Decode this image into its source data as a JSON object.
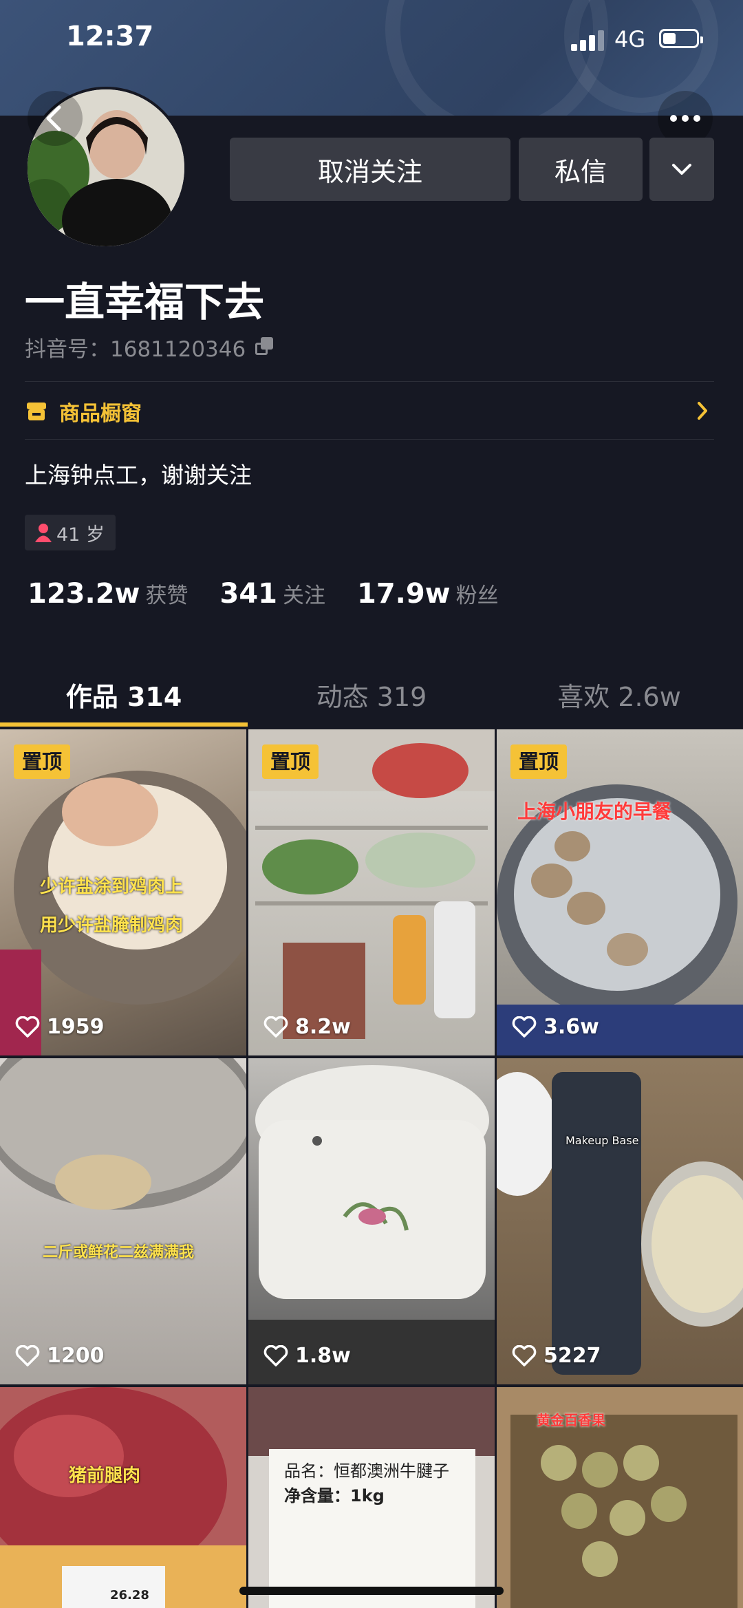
{
  "status_bar": {
    "time": "12:37",
    "network": "4G"
  },
  "profile": {
    "name": "一直幸福下去",
    "douyin_id": "抖音号：1681120346",
    "shop_label": "商品橱窗",
    "bio": "上海钟点工，谢谢关注",
    "age": "41 岁"
  },
  "actions": {
    "unfollow": "取消关注",
    "message": "私信"
  },
  "stats": [
    {
      "num": "123.2w",
      "label": "获赞"
    },
    {
      "num": "341",
      "label": "关注"
    },
    {
      "num": "17.9w",
      "label": "粉丝"
    }
  ],
  "tabs": [
    {
      "label": "作品 314"
    },
    {
      "label": "动态 319"
    },
    {
      "label": "喜欢 2.6w"
    }
  ],
  "videos": [
    {
      "likes": "1959",
      "pinned": "置顶",
      "caption1": "少许盐涂到鸡肉上",
      "caption2": "用少许盐腌制鸡肉"
    },
    {
      "likes": "8.2w",
      "pinned": "置顶"
    },
    {
      "likes": "3.6w",
      "pinned": "置顶",
      "caption1": "上海小朋友的早餐"
    },
    {
      "likes": "1200",
      "caption1": "二斤或鲜花二兹满满我"
    },
    {
      "likes": "1.8w"
    },
    {
      "likes": "5227",
      "caption1": "Makeup Base"
    },
    {
      "caption1": "猪前腿肉",
      "caption2": "26.28"
    },
    {
      "caption1": "品名：恒都澳洲牛腱子",
      "caption2": "净含量：1kg"
    },
    {
      "caption1": "黄金百香果"
    }
  ],
  "colors": {
    "accent": "#f5c236",
    "background": "#161823",
    "button": "#393b44"
  }
}
